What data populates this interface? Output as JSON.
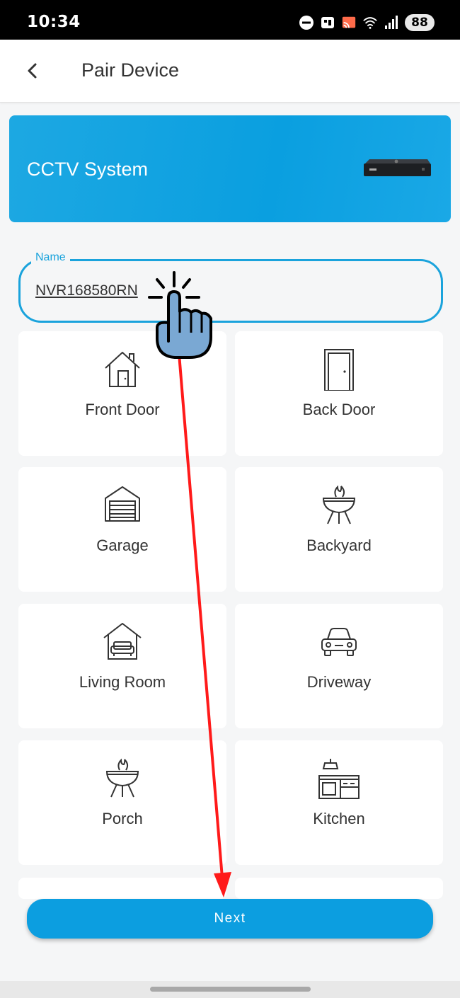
{
  "status_bar": {
    "time": "10:34",
    "battery": "88"
  },
  "app_bar": {
    "title": "Pair Device"
  },
  "banner": {
    "title": "CCTV System"
  },
  "name_field": {
    "label": "Name",
    "value": "NVR168580RN"
  },
  "locations": [
    {
      "label": "Front Door",
      "icon": "house-icon"
    },
    {
      "label": "Back Door",
      "icon": "door-icon"
    },
    {
      "label": "Garage",
      "icon": "garage-icon"
    },
    {
      "label": "Backyard",
      "icon": "grill-icon"
    },
    {
      "label": "Living Room",
      "icon": "sofa-house-icon"
    },
    {
      "label": "Driveway",
      "icon": "car-icon"
    },
    {
      "label": "Porch",
      "icon": "grill-icon"
    },
    {
      "label": "Kitchen",
      "icon": "kitchen-icon"
    }
  ],
  "next_button": {
    "label": "Next"
  },
  "colors": {
    "accent": "#0c9ee0",
    "banner": "#0a9fe0",
    "annotation_arrow": "#ff0000"
  }
}
